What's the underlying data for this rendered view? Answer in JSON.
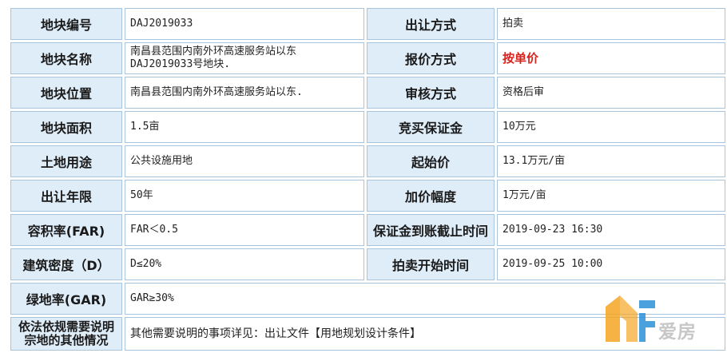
{
  "rows": [
    {
      "l1": "地块编号",
      "v1": "DAJ2019033",
      "l2": "出让方式",
      "v2": "拍卖"
    },
    {
      "l1": "地块名称",
      "v1": "南昌县范围内南外环高速服务站以东DAJ2019033号地块.",
      "l2": "报价方式",
      "v2": "按单价"
    },
    {
      "l1": "地块位置",
      "v1": "南昌县范围内南外环高速服务站以东.",
      "l2": "审核方式",
      "v2": "资格后审"
    },
    {
      "l1": "地块面积",
      "v1": "1.5亩",
      "l2": "竞买保证金",
      "v2": "10万元"
    },
    {
      "l1": "土地用途",
      "v1": "公共设施用地",
      "l2": "起始价",
      "v2": "13.1万元/亩"
    },
    {
      "l1": "出让年限",
      "v1": "50年",
      "l2": "加价幅度",
      "v2": "1万元/亩"
    },
    {
      "l1": "容积率(FAR)",
      "v1": "FAR＜0.5",
      "l2": "保证金到账截止时间",
      "v2": "2019-09-23 16:30"
    },
    {
      "l1": "建筑密度（D）",
      "v1": "D≤20%",
      "l2": "拍卖开始时间",
      "v2": "2019-09-25 10:00"
    }
  ],
  "green": {
    "label": "绿地率(GAR)",
    "value": "GAR≥30%"
  },
  "other": {
    "label": "依法依规需要说明宗地的其他情况",
    "value": "其他需要说明的事项详见：出让文件【用地规划设计条件】"
  },
  "logo": {
    "text": "爱房",
    "icon": "house-logo-icon",
    "colors": {
      "orange": "#f5a623",
      "blue": "#2b8fd8"
    }
  }
}
